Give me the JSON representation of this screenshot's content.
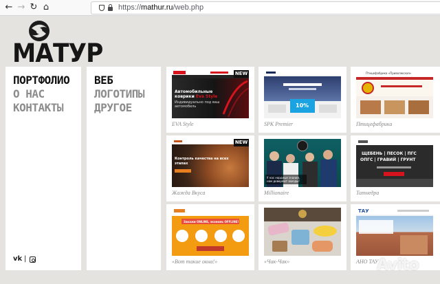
{
  "browser": {
    "url_scheme": "https://",
    "url_host": "mathur.ru",
    "url_path": "/web.php"
  },
  "site": {
    "logo_text": "МАТУР"
  },
  "main_nav": {
    "items": [
      {
        "label": "ПОРТФОЛИО",
        "active": true
      },
      {
        "label": "О НАС",
        "active": false
      },
      {
        "label": "КОНТАКТЫ",
        "active": false
      }
    ]
  },
  "portfolio_nav": {
    "items": [
      {
        "label": "ВЕБ",
        "active": true
      },
      {
        "label": "ЛОГОТИПЫ",
        "active": false
      },
      {
        "label": "ДРУГОЕ",
        "active": false
      }
    ]
  },
  "social": {
    "vk_icon": "vk-icon",
    "separator": "|",
    "instagram_icon": "instagram-icon"
  },
  "projects": [
    {
      "caption": "EVA Style",
      "badge": "NEW",
      "thumb": {
        "headline_1": "Автомобильные",
        "headline_2": "коврики",
        "brand": "Eva Style",
        "sub_1": "Индивидуально под ваш",
        "sub_2": "автомобиль"
      }
    },
    {
      "caption": "SPK Premier",
      "thumb": {
        "percent": "10%"
      }
    },
    {
      "caption": "Птицефабрика",
      "thumb": {
        "brand": "Птицефабрика «Приволжская»"
      }
    },
    {
      "caption": "Жажда Вкуса",
      "badge": "NEW",
      "thumb": {
        "headline_1": "Контроль качества на всех",
        "headline_2": "этапах"
      }
    },
    {
      "caption": "Millionaire",
      "thumb": {
        "note_1": "У нас нордные знания,",
        "note_2": "нам доверяют звезды!"
      }
    },
    {
      "caption": "Татнедра",
      "thumb": {
        "line_1": "ЩЕБЕНЬ | ПЕСОК | ПГС",
        "line_2": "ОПГС | ГРАВИЙ | ГРУНТ"
      }
    },
    {
      "caption": "«Вот такие окна!»",
      "thumb": {
        "headline_1": "Закажи ONLINE, экономь OFFLINE!"
      }
    },
    {
      "caption": "«Чак-Чак»",
      "thumb": {}
    },
    {
      "caption": "АНО ТАУ",
      "thumb": {
        "brand": "ТАУ"
      }
    }
  ],
  "watermark": {
    "text": "Avito"
  },
  "colors": {
    "page_bg": "#e4e3df",
    "panel_bg": "#ffffff",
    "accent_red": "#d7141e",
    "text_dark": "#111111",
    "text_inactive": "#8c8c8c",
    "caption_gray": "#888888"
  }
}
